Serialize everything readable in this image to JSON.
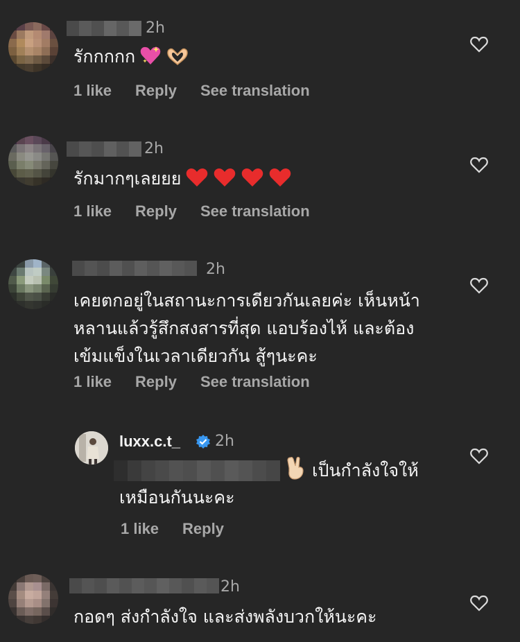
{
  "comments": [
    {
      "time": "2h",
      "text": "รักกกกก",
      "likes": "1 like",
      "reply": "Reply",
      "translate": "See translation"
    },
    {
      "time": "2h",
      "text": "รักมากๆเลยยย",
      "likes": "1 like",
      "reply": "Reply",
      "translate": "See translation"
    },
    {
      "time": "2h",
      "line1": "เคยตกอยู่ในสถานะการเดียวกันเลยค่ะ เห็นหน้า",
      "line2": "หลานแล้วรู้สึกสงสารที่สุด แอบร้องไห้ และต้อง",
      "line3": "เข้มแข็งในเวลาเดียวกัน สู้ๆนะคะ",
      "likes": "1 like",
      "reply": "Reply",
      "translate": "See translation"
    },
    {
      "username": "luxx.c.t_",
      "time": "2h",
      "line1": "เป็นกำลังใจให้",
      "line2": "เหมือนกันนะคะ",
      "likes": "1 like",
      "reply": "Reply"
    },
    {
      "time": "2h",
      "text": "กอดๆ ส่งกำลังใจ และส่งพลังบวกให้นะคะ"
    }
  ]
}
